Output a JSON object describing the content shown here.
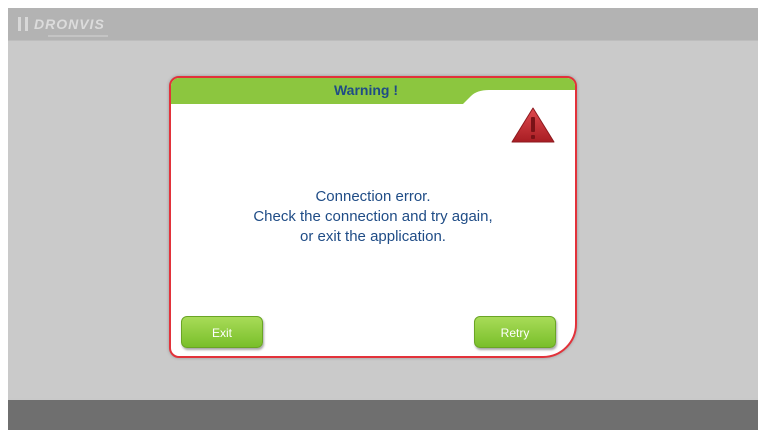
{
  "app": {
    "brand_name": "DRONVIS"
  },
  "dialog": {
    "title": "Warning !",
    "message_lines": [
      "Connection error.",
      "Check the connection and try again,",
      "or exit the application."
    ],
    "icon": "warning-triangle-icon",
    "buttons": {
      "exit_label": "Exit",
      "retry_label": "Retry"
    }
  },
  "colors": {
    "header_green": "#8cc63f",
    "dialog_border": "#e2323a",
    "text_blue": "#1f4c86",
    "warning_red": "#c9252c",
    "background_gray": "#cacaca",
    "footer_gray": "#6f6f6f"
  }
}
